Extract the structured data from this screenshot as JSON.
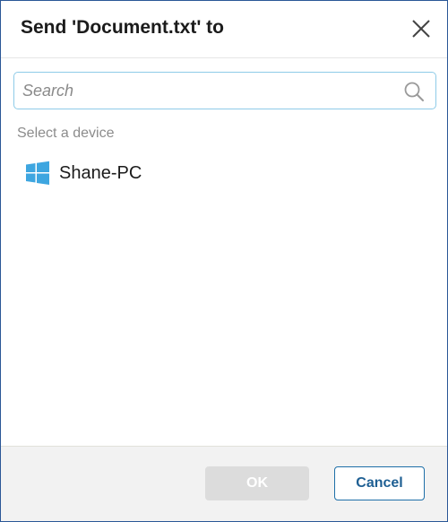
{
  "dialog": {
    "title": "Send 'Document.txt' to",
    "close_icon": "close-icon"
  },
  "search": {
    "placeholder": "Search",
    "value": "",
    "icon": "search-icon"
  },
  "devices": {
    "section_label": "Select a device",
    "items": [
      {
        "label": "Shane-PC",
        "icon": "windows-icon"
      }
    ]
  },
  "footer": {
    "ok_label": "OK",
    "cancel_label": "Cancel"
  },
  "colors": {
    "accent": "#1e6fa8",
    "windows_logo": "#3ea6e0",
    "search_border": "#8ecbe8",
    "disabled_button": "#dcdcdc",
    "footer_bg": "#f2f2f2"
  }
}
